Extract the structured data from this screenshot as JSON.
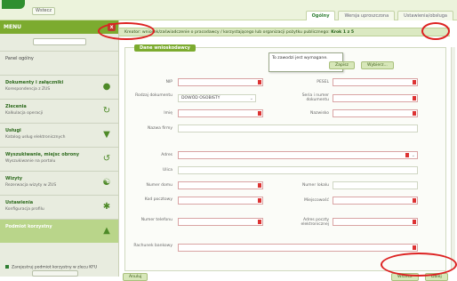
{
  "topbar": {
    "back_label": "Wstecz",
    "tabs": [
      "Ogólny",
      "Wersja uproszczona",
      "Ustawienia/obsługa"
    ]
  },
  "sidebar": {
    "menu_label": "MENU",
    "close_label": "x",
    "items": [
      {
        "title": "Panel ogólny",
        "sub": ""
      },
      {
        "title": "Dokumenty i załączniki",
        "sub": "Korespondencja z ZUS"
      },
      {
        "title": "Zlecenia",
        "sub": "Kalkulacja operacji"
      },
      {
        "title": "Usługi",
        "sub": "Katalog usług elektronicznych"
      },
      {
        "title": "Wyszukiwanie, miejsc obrony",
        "sub": "Wyszukiwanie na portalu"
      },
      {
        "title": "Wizyty",
        "sub": "Rezerwacja wizyty w ZUS"
      },
      {
        "title": "Ustawienia",
        "sub": "Konfiguracja profilu"
      },
      {
        "title": "Podmiot korzystny",
        "sub": ""
      }
    ],
    "footer": "Zarejestruj podmiot korzystny w zlecu KFU"
  },
  "main": {
    "wizard_text": "Kreator: wniosek/zaświadczenie o pracodawcy / korzystającego lub organizacji pożytku publicznego:",
    "wizard_step": "Krok 1 z 5",
    "panel_title": "Dane wnioskodawcy",
    "tooltip": "To zawodzi jest wymagane.",
    "btn_zapisz": "Zapisz",
    "btn_wybierz": "Wybierz...",
    "labels": {
      "nip": "NIP",
      "pesel": "PESEL",
      "rodzaj_dok": "Rodzaj dokumentu",
      "seria_dok": "Seria i numer dokumentu",
      "imie": "Imię",
      "nazwisko": "Nazwisko",
      "nazwa_firmy": "Nazwa firmy",
      "adres": "Adres",
      "ulica": "Ulica",
      "numer_domu": "Numer domu",
      "numer_lokalu": "Numer lokalu",
      "kod_pocztowy": "Kod pocztowy",
      "miejscowosc": "Miejscowość",
      "numer_telefonu": "Numer telefonu",
      "adres_email": "Adres poczty elektronicznej",
      "rachunek": "Rachunek bankowy"
    },
    "dokument_value": "DOWÓD OSOBISTY",
    "btn_anuluj": "Anuluj",
    "btn_wstecz": "Wstecz",
    "btn_dalej": "Dalej"
  }
}
